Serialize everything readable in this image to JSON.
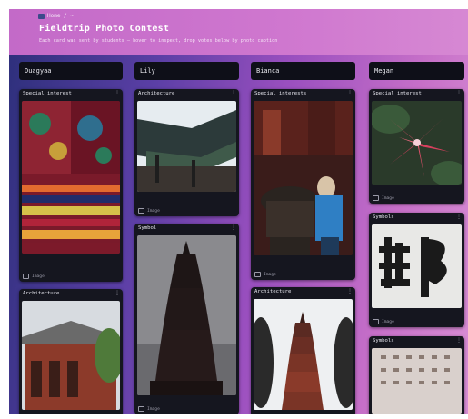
{
  "header": {
    "breadcrumb": "Home / ~",
    "title": "Fieldtrip Photo Contest",
    "subtitle": "Each card was sent by students — hover to inspect, drop votes below by photo caption"
  },
  "columns": [
    {
      "name": "Duagyaa",
      "cards": [
        {
          "title": "Special interest",
          "footer": "Image"
        },
        {
          "title": "Architecture",
          "footer": ""
        }
      ]
    },
    {
      "name": "Lily",
      "cards": [
        {
          "title": "Architecture",
          "footer": "Image"
        },
        {
          "title": "Symbol",
          "footer": "Image"
        }
      ]
    },
    {
      "name": "Bianca",
      "cards": [
        {
          "title": "Special interests",
          "footer": "Image"
        },
        {
          "title": "Architecture",
          "footer": ""
        }
      ]
    },
    {
      "name": "Megan",
      "cards": [
        {
          "title": "Special interest",
          "footer": "Image"
        },
        {
          "title": "Symbols",
          "footer": "Image"
        },
        {
          "title": "Symbols",
          "footer": ""
        }
      ]
    }
  ],
  "icons": {
    "menu": "more-vertical-icon",
    "image": "image-icon",
    "home": "home-icon"
  }
}
